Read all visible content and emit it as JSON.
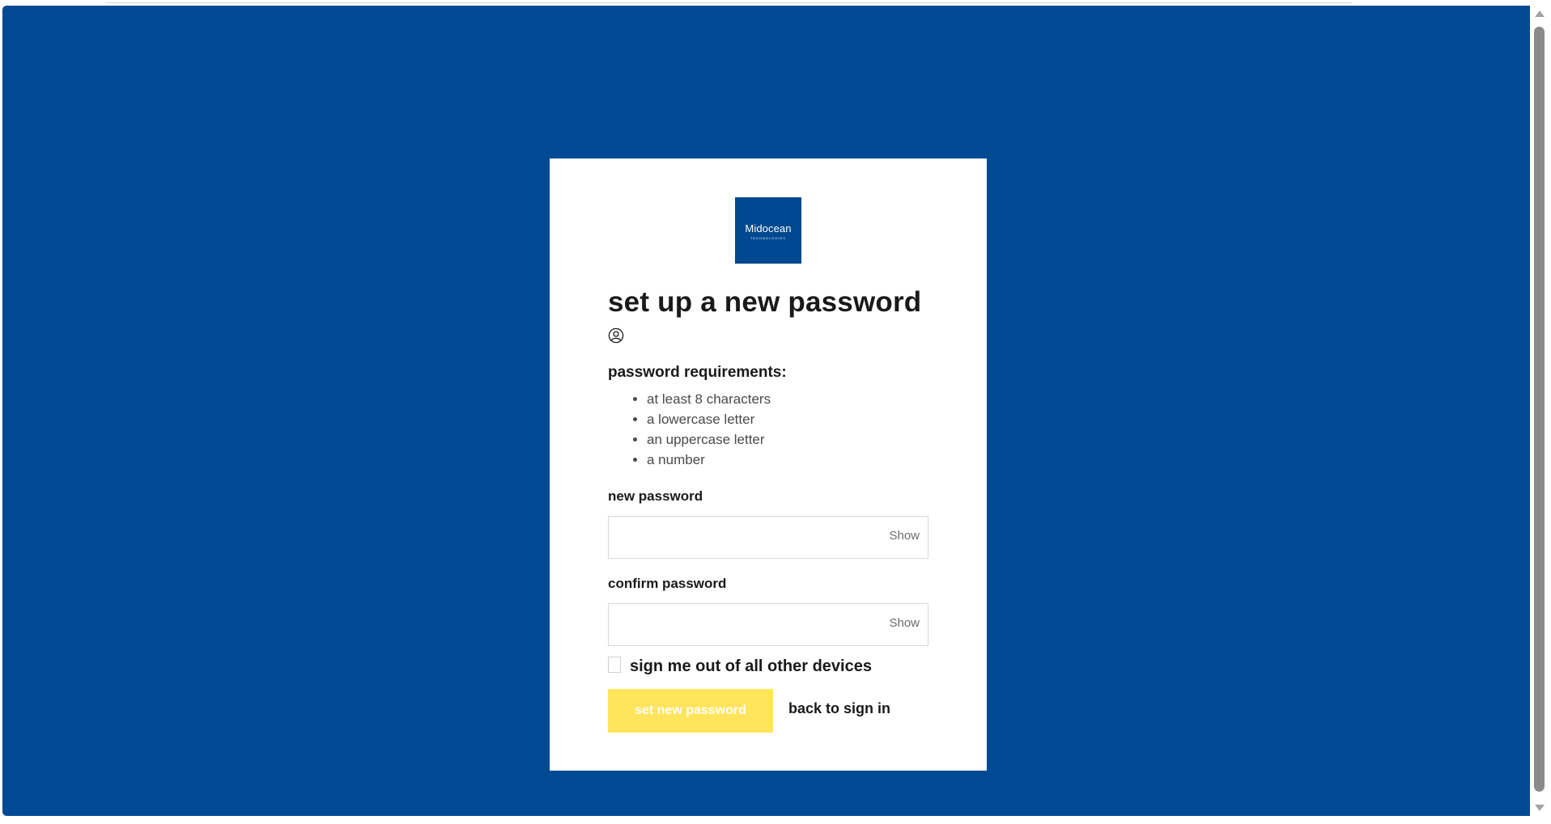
{
  "logo": {
    "name": "Midocean",
    "subtitle": "TECHNOLOGIES"
  },
  "page": {
    "title": "set up a new password"
  },
  "requirements": {
    "heading": "password requirements:",
    "items": [
      "at least 8 characters",
      "a lowercase letter",
      "an uppercase letter",
      "a number"
    ]
  },
  "new_password": {
    "label": "new password",
    "value": "",
    "toggle": "Show"
  },
  "confirm_password": {
    "label": "confirm password",
    "value": "",
    "toggle": "Show"
  },
  "sign_out_others": {
    "label": "sign me out of all other devices",
    "checked": false
  },
  "actions": {
    "submit": "set new password",
    "back": "back to sign in"
  },
  "colors": {
    "background": "#004a93",
    "card": "#ffffff",
    "logo_bg": "#00488f",
    "button": "#ffe45c",
    "button_text": "#ffffff"
  }
}
